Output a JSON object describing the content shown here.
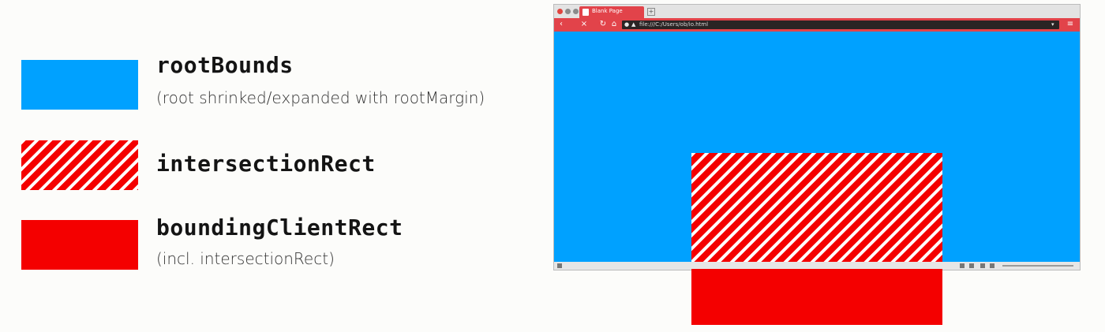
{
  "colors": {
    "root_bounds": "#00a1ff",
    "rect_red": "#f40000",
    "stripe_white": "#ffffff",
    "browser_chrome": "#e2434a",
    "page_background": "#fcfcfa"
  },
  "legend": {
    "root_bounds": {
      "title": "rootBounds",
      "note": "(root shrinked/expanded with rootMargin)"
    },
    "intersection_rect": {
      "title": "intersectionRect"
    },
    "bounding_client_rect": {
      "title": "boundingClientRect",
      "note": "(incl. intersectionRect)"
    }
  },
  "browser": {
    "tab_title": "Blank Page",
    "url": "file:///C:/Users/ob/io.html",
    "icons": {
      "close_window": "close-dot",
      "back": "arrow-left-icon",
      "stop": "stop-icon",
      "reload": "reload-icon",
      "home": "home-icon",
      "menu": "menu-icon"
    }
  }
}
